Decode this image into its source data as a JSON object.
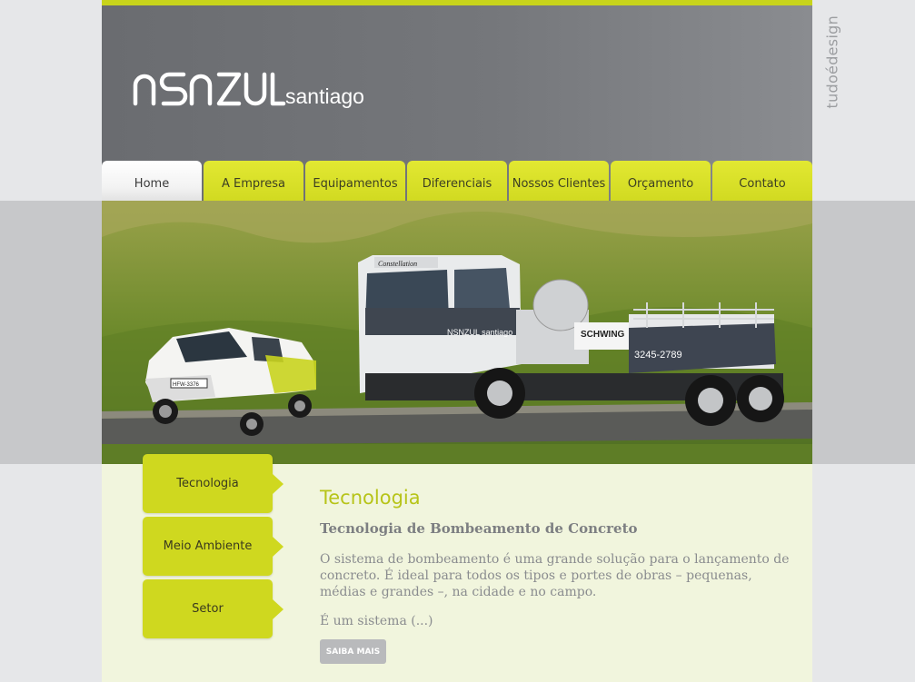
{
  "brand": {
    "logo_main": "NSNZUL",
    "logo_sub": "santiago",
    "credit": "tudoédesign"
  },
  "nav": {
    "items": [
      "Home",
      "A Empresa",
      "Equipamentos",
      "Diferenciais",
      "Nossos Clientes",
      "Orçamento",
      "Contato"
    ],
    "active_index": 0
  },
  "hero": {
    "truck_cab_label": "Constellation",
    "truck_logo": "NSNZUL santiago",
    "truck_brand": "SCHWING",
    "truck_phone": "3245-2789",
    "car_plate": "HFW-3376"
  },
  "sidebar": {
    "tabs": [
      "Tecnologia",
      "Meio Ambiente",
      "Setor"
    ]
  },
  "content": {
    "title": "Tecnologia",
    "subtitle": "Tecnologia de Bombeamento de Concreto",
    "paragraph": "O sistema de bombeamento é uma grande solução para o lançamento de concreto. É ideal para todos os tipos e portes de obras – pequenas, médias e grandes –, na cidade e no campo.",
    "more": "É um sistema (...)",
    "button": "SAIBA MAIS"
  },
  "colors": {
    "accent": "#cfd81f",
    "header": "#75777b",
    "content_bg": "#f1f5dd"
  }
}
